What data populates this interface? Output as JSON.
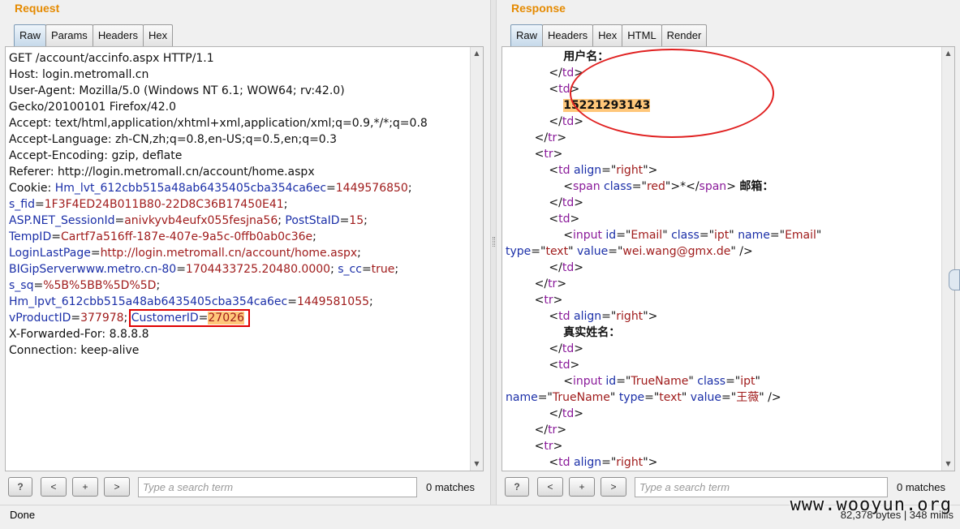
{
  "request": {
    "title": "Request",
    "tabs": [
      "Raw",
      "Params",
      "Headers",
      "Hex"
    ],
    "lines": {
      "l1": "GET /account/accinfo.aspx HTTP/1.1",
      "l2": "Host: login.metromall.cn",
      "l3": "User-Agent: Mozilla/5.0 (Windows NT 6.1; WOW64; rv:42.0)",
      "l4": "Gecko/20100101 Firefox/42.0",
      "l5": "Accept: text/html,application/xhtml+xml,application/xml;q=0.9,*/*;q=0.8",
      "l6": "Accept-Language: zh-CN,zh;q=0.8,en-US;q=0.5,en;q=0.3",
      "l7": "Accept-Encoding: gzip, deflate",
      "l8": "Referer: http://login.metromall.cn/account/home.aspx",
      "l18": "X-Forwarded-For: 8.8.8.8",
      "l19": "Connection: keep-alive"
    },
    "cookie": {
      "label": "Cookie: ",
      "k1": "Hm_lvt_612cbb515a48ab6435405cba354ca6ec",
      "v1": "1449576850",
      "k2": "s_fid",
      "v2": "1F3F4ED24B011B80-22D8C36B17450E41",
      "k3": "ASP.NET_SessionId",
      "v3": "anivkyvb4eufx055fesjna56",
      "k4": "PostStaID",
      "v4": "15",
      "k5": "TempID",
      "v5": "Cartf7a516ff-187e-407e-9a5c-0ffb0ab0c36e",
      "k6": "LoginLastPage",
      "v6": "http://login.metromall.cn/account/home.aspx",
      "k7": "BIGipServerwww.metro.cn-80",
      "v7": "1704433725.20480.0000",
      "k8": "s_cc",
      "v8": "true",
      "k9": "s_sq",
      "v9": "%5B%5BB%5D%5D",
      "k10": "Hm_lpvt_612cbb515a48ab6435405cba354ca6ec",
      "v10": "1449581055",
      "k11": "vProductID",
      "v11": "377978",
      "k12": "CustomerID",
      "v12": "27026"
    },
    "search": {
      "placeholder": "Type a search term",
      "matches": "0 matches"
    },
    "buttons": {
      "help": "?",
      "prev": "<",
      "add": "+",
      "next": ">"
    }
  },
  "response": {
    "title": "Response",
    "tabs": [
      "Raw",
      "Headers",
      "Hex",
      "HTML",
      "Render"
    ],
    "html": {
      "username_label": "用户名：",
      "phone": "15221293143",
      "star": "*",
      "email_label": "邮箱：",
      "email_id": "Email",
      "email_class": "ipt",
      "email_name": "Email",
      "email_type": "text",
      "email_value": "wei.wang@gmx.de",
      "realname_label": "真实姓名：",
      "tn_id": "TrueName",
      "tn_class": "ipt",
      "tn_name": "TrueName",
      "tn_type": "text",
      "tn_value": "王薇",
      "align_value": "right",
      "span_class": "red"
    },
    "search": {
      "placeholder": "Type a search term",
      "matches": "0 matches"
    },
    "buttons": {
      "help": "?",
      "prev": "<",
      "add": "+",
      "next": ">"
    }
  },
  "status": {
    "left": "Done",
    "right": "82,378 bytes | 348 millis"
  },
  "watermark": "www.wooyun.org",
  "colors": {
    "title_orange": "#e58a00",
    "highlight": "#ffc77a",
    "annotation_red": "#e00000"
  }
}
